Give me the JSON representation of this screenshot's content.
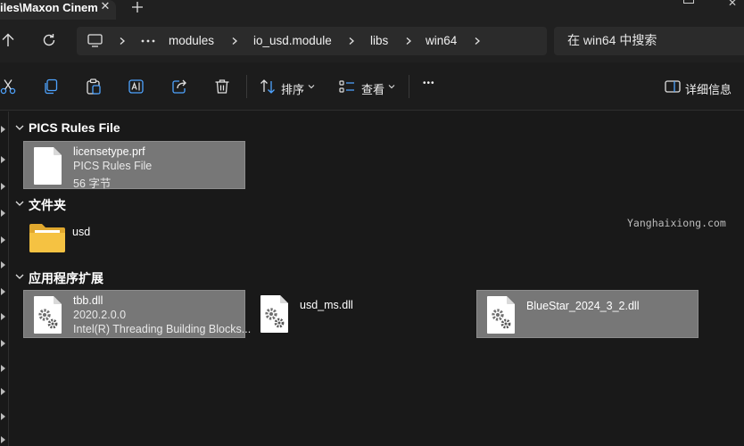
{
  "window": {
    "tab_title": "iles\\Maxon Cinem",
    "tab_close_glyph": "✕",
    "new_tab_glyph": "+",
    "close_glyph": "✕"
  },
  "address": {
    "crumbs": [
      "modules",
      "io_usd.module",
      "libs",
      "win64"
    ],
    "search_placeholder": "在 win64 中搜索"
  },
  "toolbar": {
    "sort_label": "排序",
    "view_label": "查看",
    "details_label": "详细信息",
    "more_glyph": "•••"
  },
  "groups": [
    {
      "title": "PICS Rules File",
      "items": [
        {
          "name": "licensetype.prf",
          "type": "PICS Rules File",
          "size": "56 字节",
          "icon": "document-icon",
          "selected": true
        }
      ]
    },
    {
      "title": "文件夹",
      "items": [
        {
          "name": "usd",
          "icon": "folder-icon",
          "selected": false
        }
      ]
    },
    {
      "title": "应用程序扩展",
      "items": [
        {
          "name": "tbb.dll",
          "version": "2020.2.0.0",
          "description": "Intel(R) Threading Building Blocks...",
          "icon": "dll-gear-icon",
          "selected": true
        },
        {
          "name": "usd_ms.dll",
          "icon": "dll-gear-icon",
          "selected": false
        },
        {
          "name": "BlueStar_2024_3_2.dll",
          "icon": "dll-gear-icon",
          "selected": true
        }
      ]
    }
  ],
  "watermark": "Yanghaixiong.com",
  "colors": {
    "background": "#191919",
    "selection": "#777777",
    "folder_yellow": "#f5c242"
  }
}
